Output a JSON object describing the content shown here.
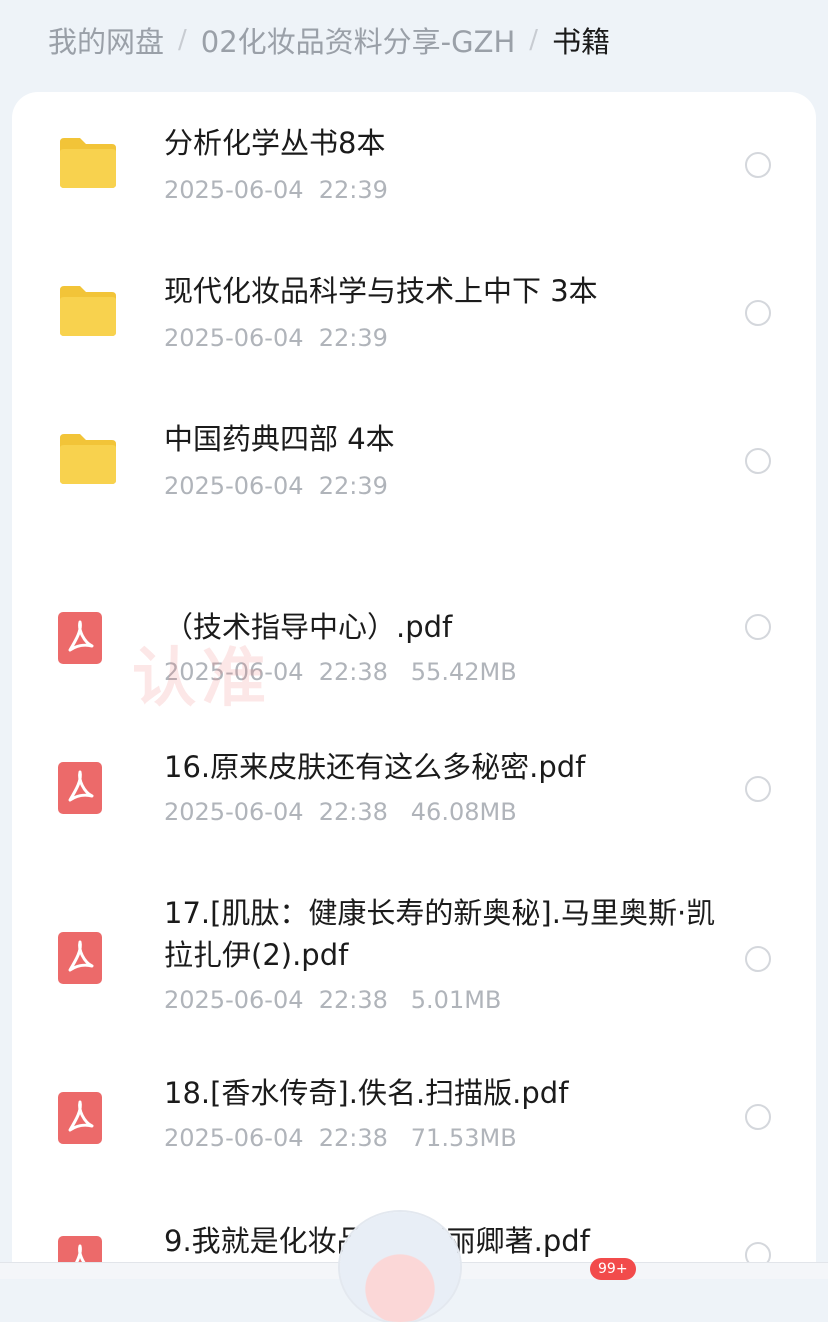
{
  "breadcrumb": {
    "root": "我的网盘",
    "folder": "02化妆品资料分享-GZH",
    "current": "书籍"
  },
  "files": [
    {
      "type": "folder",
      "name": "分析化学丛书8本",
      "meta": "2025-06-04  22:39"
    },
    {
      "type": "folder",
      "name": "现代化妆品科学与技术上中下 3本",
      "meta": "2025-06-04  22:39"
    },
    {
      "type": "folder",
      "name": "中国药典四部  4本",
      "meta": "2025-06-04  22:39"
    },
    {
      "type": "pdf",
      "name": "（技术指导中心）.pdf",
      "meta": "2025-06-04  22:38   55.42MB"
    },
    {
      "type": "pdf",
      "name": "16.原来皮肤还有这么多秘密.pdf",
      "meta": "2025-06-04  22:38   46.08MB"
    },
    {
      "type": "pdf",
      "name": "17.[肌肽：健康长寿的新奥秘].马里奥斯·凯拉扎伊(2).pdf",
      "meta": "2025-06-04  22:38   5.01MB"
    },
    {
      "type": "pdf",
      "name": "18.[香水传奇].佚名.扫描版.pdf",
      "meta": "2025-06-04  22:38   71.53MB"
    },
    {
      "type": "pdf",
      "name": "9.我就是化妆品     2+张丽卿著.pdf",
      "meta": ""
    }
  ],
  "watermark": "认准",
  "tabbar": {
    "badge": "99+"
  },
  "colors": {
    "folder": "#f8d24e",
    "pdf": "#ec6a6a",
    "background": "#eef3f8"
  }
}
